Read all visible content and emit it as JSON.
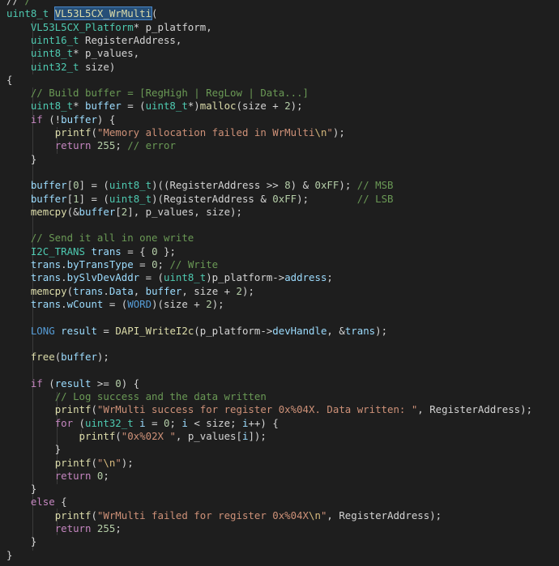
{
  "theme": {
    "background": "#1e1e1e",
    "selection": "#264f78",
    "colors": {
      "kw": "#569cd6",
      "ctl": "#c586c0",
      "type": "#4ec9b0",
      "fn": "#dcdcaa",
      "var": "#9cdcfe",
      "str": "#ce9178",
      "esc": "#d7ba7d",
      "num": "#b5cea8",
      "cmt": "#6a9955",
      "pl": "#d4d4d4"
    }
  },
  "code": {
    "lines": [
      [
        [
          "pl",
          "//"
        ],
        [
          "cmt",
          " /"
        ]
      ],
      [
        [
          "type",
          "uint8_t"
        ],
        [
          "pl",
          " "
        ],
        [
          "sel",
          "VL53L5CX_WrMulti"
        ],
        [
          "pl",
          "("
        ]
      ],
      [
        [
          "pl",
          "    "
        ],
        [
          "type",
          "VL53L5CX_Platform"
        ],
        [
          "pl",
          "* p_platform,"
        ]
      ],
      [
        [
          "pl",
          "    "
        ],
        [
          "type",
          "uint16_t"
        ],
        [
          "pl",
          " RegisterAddress,"
        ]
      ],
      [
        [
          "pl",
          "    "
        ],
        [
          "type",
          "uint8_t"
        ],
        [
          "pl",
          "* p_values,"
        ]
      ],
      [
        [
          "pl",
          "    "
        ],
        [
          "type",
          "uint32_t"
        ],
        [
          "pl",
          " size)"
        ]
      ],
      [
        [
          "pl",
          "{"
        ]
      ],
      [
        [
          "pl",
          "    "
        ],
        [
          "cmt",
          "// Build buffer = [RegHigh | RegLow | Data...]"
        ]
      ],
      [
        [
          "pl",
          "    "
        ],
        [
          "type",
          "uint8_t"
        ],
        [
          "pl",
          "* "
        ],
        [
          "var",
          "buffer"
        ],
        [
          "pl",
          " = ("
        ],
        [
          "type",
          "uint8_t"
        ],
        [
          "pl",
          "*)"
        ],
        [
          "fn",
          "malloc"
        ],
        [
          "pl",
          "(size + "
        ],
        [
          "num",
          "2"
        ],
        [
          "pl",
          ");"
        ]
      ],
      [
        [
          "pl",
          "    "
        ],
        [
          "ctl",
          "if"
        ],
        [
          "pl",
          " (!"
        ],
        [
          "var",
          "buffer"
        ],
        [
          "pl",
          ") {"
        ]
      ],
      [
        [
          "pl",
          "        "
        ],
        [
          "fn",
          "printf"
        ],
        [
          "pl",
          "("
        ],
        [
          "str",
          "\"Memory allocation failed in WrMulti"
        ],
        [
          "esc",
          "\\n"
        ],
        [
          "str",
          "\""
        ],
        [
          "pl",
          ");"
        ]
      ],
      [
        [
          "pl",
          "        "
        ],
        [
          "ctl",
          "return"
        ],
        [
          "pl",
          " "
        ],
        [
          "num",
          "255"
        ],
        [
          "pl",
          "; "
        ],
        [
          "cmt",
          "// error"
        ]
      ],
      [
        [
          "pl",
          "    }"
        ]
      ],
      [
        [
          "pl",
          ""
        ]
      ],
      [
        [
          "pl",
          "    "
        ],
        [
          "var",
          "buffer"
        ],
        [
          "pl",
          "["
        ],
        [
          "num",
          "0"
        ],
        [
          "pl",
          "] = ("
        ],
        [
          "type",
          "uint8_t"
        ],
        [
          "pl",
          ")((RegisterAddress >> "
        ],
        [
          "num",
          "8"
        ],
        [
          "pl",
          ") & "
        ],
        [
          "num",
          "0xFF"
        ],
        [
          "pl",
          "); "
        ],
        [
          "cmt",
          "// MSB"
        ]
      ],
      [
        [
          "pl",
          "    "
        ],
        [
          "var",
          "buffer"
        ],
        [
          "pl",
          "["
        ],
        [
          "num",
          "1"
        ],
        [
          "pl",
          "] = ("
        ],
        [
          "type",
          "uint8_t"
        ],
        [
          "pl",
          ")(RegisterAddress & "
        ],
        [
          "num",
          "0xFF"
        ],
        [
          "pl",
          ");        "
        ],
        [
          "cmt",
          "// LSB"
        ]
      ],
      [
        [
          "pl",
          "    "
        ],
        [
          "fn",
          "memcpy"
        ],
        [
          "pl",
          "(&"
        ],
        [
          "var",
          "buffer"
        ],
        [
          "pl",
          "["
        ],
        [
          "num",
          "2"
        ],
        [
          "pl",
          "], p_values, size);"
        ]
      ],
      [
        [
          "pl",
          ""
        ]
      ],
      [
        [
          "pl",
          "    "
        ],
        [
          "cmt",
          "// Send it all in one write"
        ]
      ],
      [
        [
          "pl",
          "    "
        ],
        [
          "type",
          "I2C_TRANS"
        ],
        [
          "pl",
          " "
        ],
        [
          "var",
          "trans"
        ],
        [
          "pl",
          " = { "
        ],
        [
          "num",
          "0"
        ],
        [
          "pl",
          " };"
        ]
      ],
      [
        [
          "pl",
          "    "
        ],
        [
          "var",
          "trans"
        ],
        [
          "pl",
          "."
        ],
        [
          "var",
          "byTransType"
        ],
        [
          "pl",
          " = "
        ],
        [
          "num",
          "0"
        ],
        [
          "pl",
          "; "
        ],
        [
          "cmt",
          "// Write"
        ]
      ],
      [
        [
          "pl",
          "    "
        ],
        [
          "var",
          "trans"
        ],
        [
          "pl",
          "."
        ],
        [
          "var",
          "bySlvDevAddr"
        ],
        [
          "pl",
          " = ("
        ],
        [
          "type",
          "uint8_t"
        ],
        [
          "pl",
          ")p_platform->"
        ],
        [
          "var",
          "address"
        ],
        [
          "pl",
          ";"
        ]
      ],
      [
        [
          "pl",
          "    "
        ],
        [
          "fn",
          "memcpy"
        ],
        [
          "pl",
          "("
        ],
        [
          "var",
          "trans"
        ],
        [
          "pl",
          "."
        ],
        [
          "var",
          "Data"
        ],
        [
          "pl",
          ", "
        ],
        [
          "var",
          "buffer"
        ],
        [
          "pl",
          ", size + "
        ],
        [
          "num",
          "2"
        ],
        [
          "pl",
          ");"
        ]
      ],
      [
        [
          "pl",
          "    "
        ],
        [
          "var",
          "trans"
        ],
        [
          "pl",
          "."
        ],
        [
          "var",
          "wCount"
        ],
        [
          "pl",
          " = ("
        ],
        [
          "kw",
          "WORD"
        ],
        [
          "pl",
          ")(size + "
        ],
        [
          "num",
          "2"
        ],
        [
          "pl",
          ");"
        ]
      ],
      [
        [
          "pl",
          ""
        ]
      ],
      [
        [
          "pl",
          "    "
        ],
        [
          "kw",
          "LONG"
        ],
        [
          "pl",
          " "
        ],
        [
          "var",
          "result"
        ],
        [
          "pl",
          " = "
        ],
        [
          "fn",
          "DAPI_WriteI2c"
        ],
        [
          "pl",
          "(p_platform->"
        ],
        [
          "var",
          "devHandle"
        ],
        [
          "pl",
          ", &"
        ],
        [
          "var",
          "trans"
        ],
        [
          "pl",
          ");"
        ]
      ],
      [
        [
          "pl",
          ""
        ]
      ],
      [
        [
          "pl",
          "    "
        ],
        [
          "fn",
          "free"
        ],
        [
          "pl",
          "("
        ],
        [
          "var",
          "buffer"
        ],
        [
          "pl",
          ");"
        ]
      ],
      [
        [
          "pl",
          ""
        ]
      ],
      [
        [
          "pl",
          "    "
        ],
        [
          "ctl",
          "if"
        ],
        [
          "pl",
          " ("
        ],
        [
          "var",
          "result"
        ],
        [
          "pl",
          " >= "
        ],
        [
          "num",
          "0"
        ],
        [
          "pl",
          ") {"
        ]
      ],
      [
        [
          "pl",
          "        "
        ],
        [
          "cmt",
          "// Log success and the data written"
        ]
      ],
      [
        [
          "pl",
          "        "
        ],
        [
          "fn",
          "printf"
        ],
        [
          "pl",
          "("
        ],
        [
          "str",
          "\"WrMulti success for register 0x%04X. Data written: \""
        ],
        [
          "pl",
          ", RegisterAddress);"
        ]
      ],
      [
        [
          "pl",
          "        "
        ],
        [
          "ctl",
          "for"
        ],
        [
          "pl",
          " ("
        ],
        [
          "type",
          "uint32_t"
        ],
        [
          "pl",
          " "
        ],
        [
          "var",
          "i"
        ],
        [
          "pl",
          " = "
        ],
        [
          "num",
          "0"
        ],
        [
          "pl",
          "; "
        ],
        [
          "var",
          "i"
        ],
        [
          "pl",
          " < size; "
        ],
        [
          "var",
          "i"
        ],
        [
          "pl",
          "++) {"
        ]
      ],
      [
        [
          "pl",
          "            "
        ],
        [
          "fn",
          "printf"
        ],
        [
          "pl",
          "("
        ],
        [
          "str",
          "\"0x%02X \""
        ],
        [
          "pl",
          ", p_values["
        ],
        [
          "var",
          "i"
        ],
        [
          "pl",
          "]);"
        ]
      ],
      [
        [
          "pl",
          "        }"
        ]
      ],
      [
        [
          "pl",
          "        "
        ],
        [
          "fn",
          "printf"
        ],
        [
          "pl",
          "("
        ],
        [
          "str",
          "\""
        ],
        [
          "esc",
          "\\n"
        ],
        [
          "str",
          "\""
        ],
        [
          "pl",
          ");"
        ]
      ],
      [
        [
          "pl",
          "        "
        ],
        [
          "ctl",
          "return"
        ],
        [
          "pl",
          " "
        ],
        [
          "num",
          "0"
        ],
        [
          "pl",
          ";"
        ]
      ],
      [
        [
          "pl",
          "    }"
        ]
      ],
      [
        [
          "pl",
          "    "
        ],
        [
          "ctl",
          "else"
        ],
        [
          "pl",
          " {"
        ]
      ],
      [
        [
          "pl",
          "        "
        ],
        [
          "fn",
          "printf"
        ],
        [
          "pl",
          "("
        ],
        [
          "str",
          "\"WrMulti failed for register 0x%04X"
        ],
        [
          "esc",
          "\\n"
        ],
        [
          "str",
          "\""
        ],
        [
          "pl",
          ", RegisterAddress);"
        ]
      ],
      [
        [
          "pl",
          "        "
        ],
        [
          "ctl",
          "return"
        ],
        [
          "pl",
          " "
        ],
        [
          "num",
          "255"
        ],
        [
          "pl",
          ";"
        ]
      ],
      [
        [
          "pl",
          "    }"
        ]
      ],
      [
        [
          "pl",
          "}"
        ]
      ]
    ]
  }
}
